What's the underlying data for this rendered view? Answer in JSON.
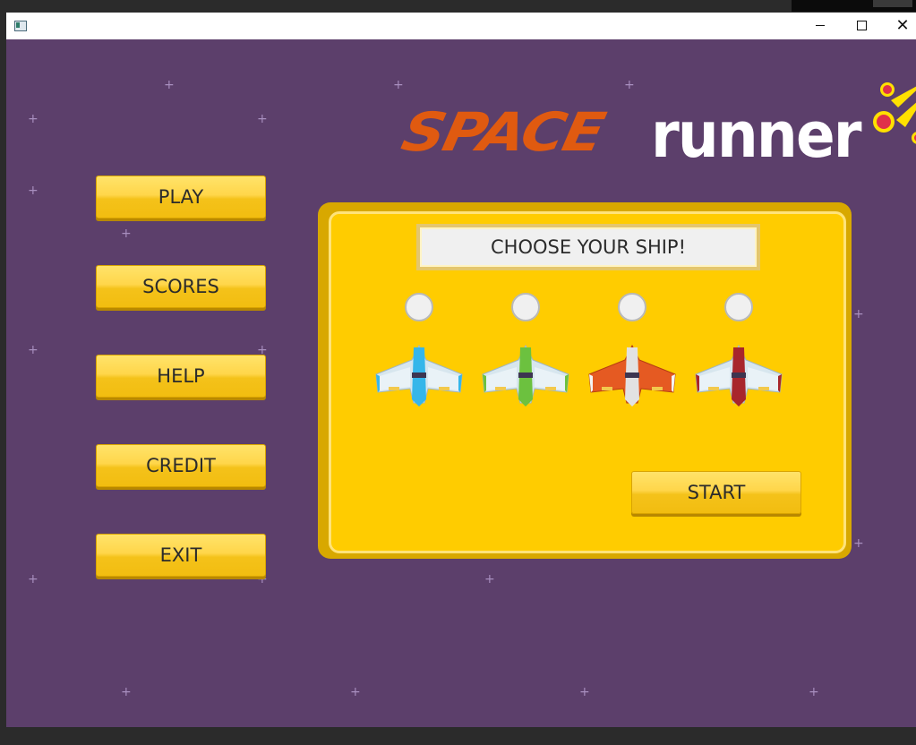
{
  "window": {
    "title": "",
    "controls": {
      "minimize": "",
      "maximize": "",
      "close": "✕"
    }
  },
  "logo": {
    "part1": "SPACE",
    "part2": "runner"
  },
  "menu": {
    "play": "PLAY",
    "scores": "SCORES",
    "help": "HELP",
    "credit": "CREDIT",
    "exit": "EXIT"
  },
  "ship_panel": {
    "heading": "CHOOSE YOUR SHIP!",
    "ships": [
      {
        "icon": "blue-ship-icon",
        "color": "#35b6ea"
      },
      {
        "icon": "green-ship-icon",
        "color": "#6cc13f"
      },
      {
        "icon": "orange-ship-icon",
        "color": "#e55a22"
      },
      {
        "icon": "red-ship-icon",
        "color": "#a8262c"
      }
    ],
    "start_label": "START"
  },
  "colors": {
    "background": "#5c3f6b",
    "panel": "#ffcc00",
    "button": "#ffd64a",
    "logo_space": "#e05a10",
    "logo_runner": "#ffffff"
  }
}
